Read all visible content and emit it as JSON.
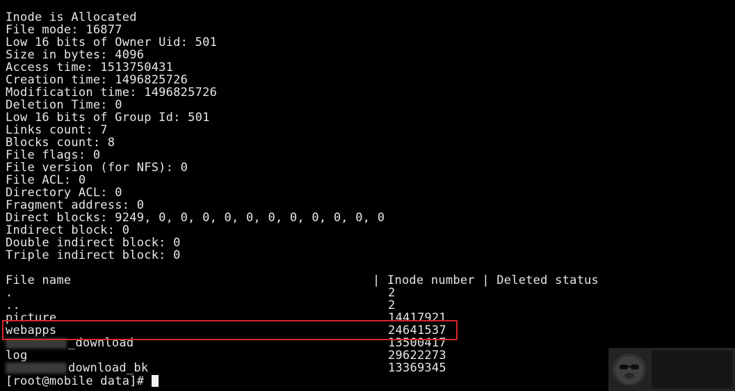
{
  "inode_info": [
    "Inode is Allocated",
    "File mode: 16877",
    "Low 16 bits of Owner Uid: 501",
    "Size in bytes: 4096",
    "Access time: 1513750431",
    "Creation time: 1496825726",
    "Modification time: 1496825726",
    "Deletion Time: 0",
    "Low 16 bits of Group Id: 501",
    "Links count: 7",
    "Blocks count: 8",
    "File flags: 0",
    "File version (for NFS): 0",
    "File ACL: 0",
    "Directory ACL: 0",
    "Fragment address: 0",
    "Direct blocks: 9249, 0, 0, 0, 0, 0, 0, 0, 0, 0, 0, 0",
    "Indirect block: 0",
    "Double indirect block: 0",
    "Triple indirect block: 0"
  ],
  "table": {
    "header_name": "File name",
    "header_rest": "| Inode number | Deleted status",
    "rows": [
      {
        "name": ".",
        "inode": "2"
      },
      {
        "name": "..",
        "inode": "2"
      },
      {
        "name": "picture",
        "inode": "14417921"
      },
      {
        "name": "webapps",
        "inode": "24641537"
      },
      {
        "name": "_download",
        "inode": "13500417"
      },
      {
        "name": "log",
        "inode": "29622273"
      },
      {
        "name": "download_bk",
        "inode": "13369345"
      }
    ]
  },
  "prompt": "[root@mobile data]# ",
  "colors": {
    "background": "#000000",
    "text": "#e8e8e8",
    "highlight": "#d9262b"
  }
}
